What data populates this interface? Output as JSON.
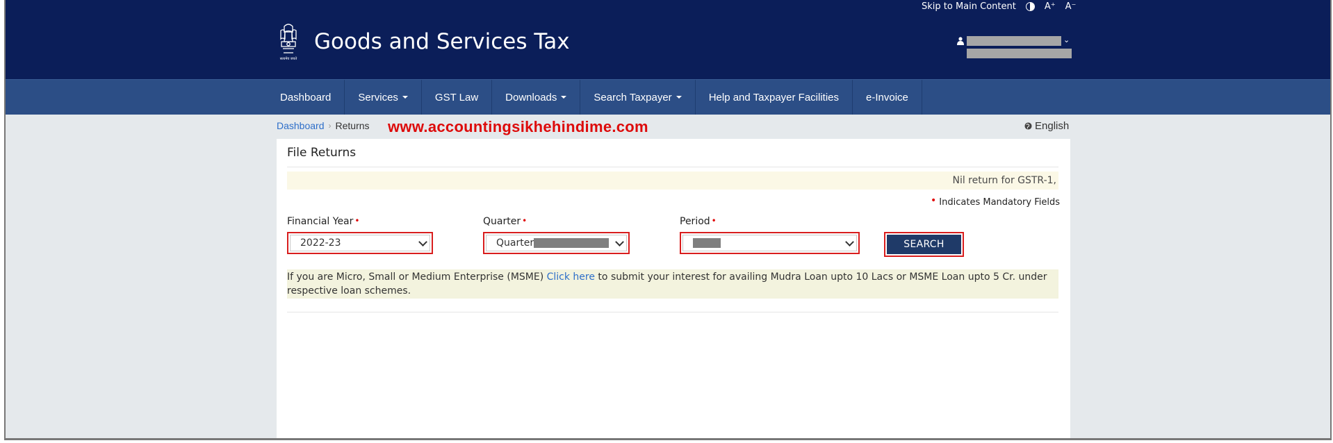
{
  "topbar": {
    "skip_link": "Skip to Main Content",
    "font_increase": "A⁺",
    "font_decrease": "A⁻"
  },
  "header": {
    "site_title": "Goods and Services Tax"
  },
  "nav": {
    "items": [
      {
        "label": "Dashboard",
        "has_dropdown": false
      },
      {
        "label": "Services",
        "has_dropdown": true
      },
      {
        "label": "GST Law",
        "has_dropdown": false
      },
      {
        "label": "Downloads",
        "has_dropdown": true
      },
      {
        "label": "Search Taxpayer",
        "has_dropdown": true
      },
      {
        "label": "Help and Taxpayer Facilities",
        "has_dropdown": false
      },
      {
        "label": "e-Invoice",
        "has_dropdown": false
      }
    ]
  },
  "breadcrumb": {
    "home": "Dashboard",
    "current": "Returns"
  },
  "watermark": "www.accountingsikhehindime.com",
  "language": "English",
  "panel": {
    "title": "File Returns",
    "notice": "Nil return for GSTR-1,",
    "mandatory_note": "Indicates Mandatory Fields",
    "fields": {
      "financial_year": {
        "label": "Financial Year",
        "value": "2022-23"
      },
      "quarter": {
        "label": "Quarter",
        "value": "Quarter"
      },
      "period": {
        "label": "Period",
        "value": ""
      }
    },
    "search_button": "SEARCH",
    "msme": {
      "before": "If you are Micro, Small or Medium Enterprise (MSME) ",
      "link": "Click here",
      "after": " to submit your interest for availing Mudra Loan upto 10 Lacs or MSME Loan upto 5 Cr. under respective loan schemes."
    }
  },
  "colors": {
    "header_bg": "#0b1e59",
    "nav_bg": "#2c4e86",
    "highlight_border": "#d81d1d",
    "watermark": "#dd0b0b",
    "button_bg": "#1f3a68",
    "link": "#2d6ec9"
  }
}
